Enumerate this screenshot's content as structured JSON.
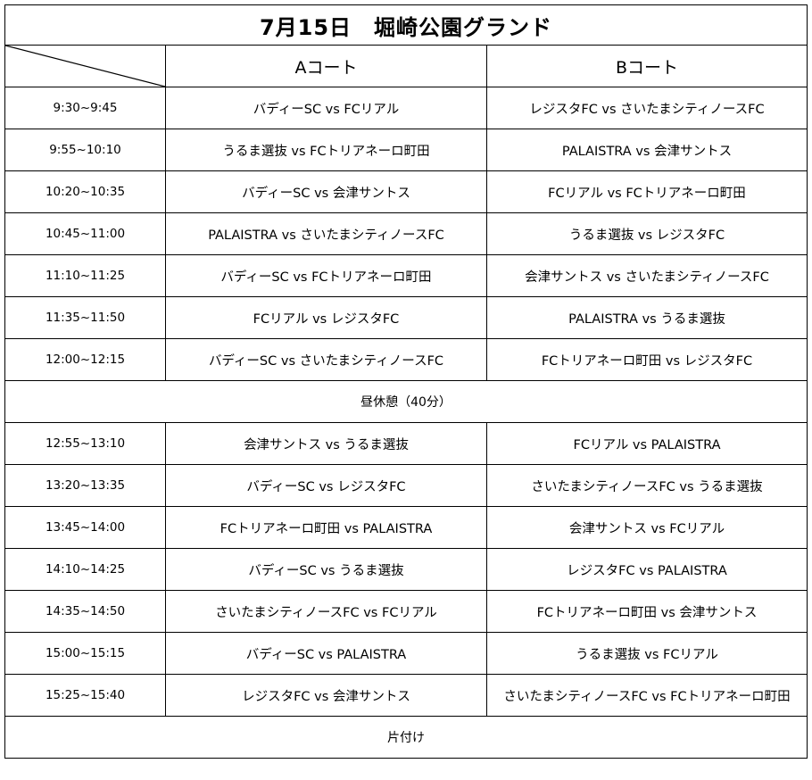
{
  "title": "7月15日　堀崎公園グランド",
  "courts": {
    "a": "Aコート",
    "b": "Bコート"
  },
  "matches_am": [
    {
      "time": "9:30~9:45",
      "a": "バディーSC vs FCリアル",
      "b": "レジスタFC vs さいたまシティノースFC"
    },
    {
      "time": "9:55~10:10",
      "a": "うるま選抜 vs FCトリアネーロ町田",
      "b": "PALAISTRA vs 会津サントス"
    },
    {
      "time": "10:20~10:35",
      "a": "バディーSC vs 会津サントス",
      "b": "FCリアル vs FCトリアネーロ町田"
    },
    {
      "time": "10:45~11:00",
      "a": "PALAISTRA vs さいたまシティノースFC",
      "b": "うるま選抜 vs レジスタFC"
    },
    {
      "time": "11:10~11:25",
      "a": "バディーSC vs FCトリアネーロ町田",
      "b": "会津サントス vs さいたまシティノースFC"
    },
    {
      "time": "11:35~11:50",
      "a": "FCリアル vs レジスタFC",
      "b": "PALAISTRA vs うるま選抜"
    },
    {
      "time": "12:00~12:15",
      "a": "バディーSC vs さいたまシティノースFC",
      "b": "FCトリアネーロ町田 vs レジスタFC"
    }
  ],
  "lunch_break": "昼休憩（40分）",
  "matches_pm": [
    {
      "time": "12:55~13:10",
      "a": "会津サントス vs うるま選抜",
      "b": "FCリアル vs PALAISTRA"
    },
    {
      "time": "13:20~13:35",
      "a": "バディーSC vs レジスタFC",
      "b": "さいたまシティノースFC vs うるま選抜"
    },
    {
      "time": "13:45~14:00",
      "a": "FCトリアネーロ町田 vs PALAISTRA",
      "b": "会津サントス vs FCリアル"
    },
    {
      "time": "14:10~14:25",
      "a": "バディーSC vs うるま選抜",
      "b": "レジスタFC vs PALAISTRA"
    },
    {
      "time": "14:35~14:50",
      "a": "さいたまシティノースFC vs FCリアル",
      "b": "FCトリアネーロ町田 vs 会津サントス"
    },
    {
      "time": "15:00~15:15",
      "a": "バディーSC vs PALAISTRA",
      "b": "うるま選抜 vs FCリアル"
    },
    {
      "time": "15:25~15:40",
      "a": "レジスタFC vs 会津サントス",
      "b": "さいたまシティノースFC vs FCトリアネーロ町田"
    }
  ],
  "cleanup": "片付け"
}
